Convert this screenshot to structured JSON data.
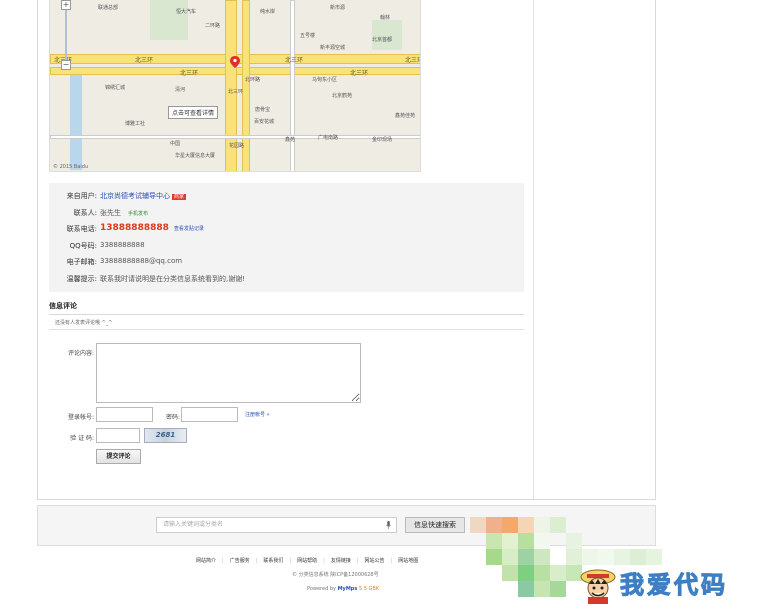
{
  "map": {
    "road_labels": [
      "北三环",
      "北三环",
      "北三环",
      "北三环",
      "北三环",
      "北三环"
    ],
    "labels": [
      "联通总部",
      "恒大汽车",
      "纯水岸",
      "新市源",
      "翰林",
      "新丰源空城",
      "二环路",
      "五号楼",
      "北京首都",
      "北环路",
      "马甸东小区",
      "北三环",
      "锦绣汇城",
      "清河",
      "北京鹤苑",
      "博雅工社",
      "唐骨宝",
      "鑫苑佳苑",
      "百安花城",
      "鑫苑",
      "花园路",
      "中国",
      "华星大厦",
      "信息大厦",
      "广电南路",
      "金印现场"
    ],
    "tip_text": "点击可查看详情",
    "copyright": "© 2015 Baidu"
  },
  "contact": {
    "from_user_label": "来自用户:",
    "from_user_value": "北京尚德考试辅导中心",
    "from_user_badge": "商家",
    "contact_label": "联系人:",
    "contact_value": "张先生",
    "contact_tag": "手机发布",
    "phone_label": "联系电话:",
    "phone_value": "13888888888",
    "phone_link": "查看发贴记录",
    "qq_label": "QQ号码:",
    "qq_value": "3388888888",
    "email_label": "电子邮箱:",
    "email_value": "33888888888@qq.com",
    "tip_label": "温馨提示:",
    "tip_value": "联系我时请说明是在分类信息系统看到的,谢谢!"
  },
  "comments": {
    "title": "信息评论",
    "empty_text": "还没有人发表评论哦 ^_^",
    "content_label": "评论内容:",
    "account_label": "登录帐号:",
    "password_label": "密码:",
    "register_link": "注册帐号 »",
    "captcha_label": "验 证 码:",
    "captcha_value": "2681",
    "submit_label": "提交评论"
  },
  "search": {
    "placeholder": "请输入关键词或分类名",
    "button_label": "信息快速搜索"
  },
  "footer": {
    "links": [
      "网站简介",
      "广告服务",
      "联系我们",
      "网站帮助",
      "友情链接",
      "网站公告",
      "网站地图"
    ],
    "copyright": "© 分类信息系统   陕ICP备12000628号",
    "powered_prefix": "Powered by",
    "powered_brand": "MyMps",
    "powered_version": "5.5 GBK"
  },
  "watermark": {
    "text": "我爱代码"
  },
  "colors": {
    "link_blue": "#2a4fb5",
    "phone_red": "#e0371f",
    "badge_red": "#e03c2a",
    "tag_green": "#2e8b2e",
    "road_yellow": "#f8e27a",
    "info_bg": "#f3f3f3"
  }
}
